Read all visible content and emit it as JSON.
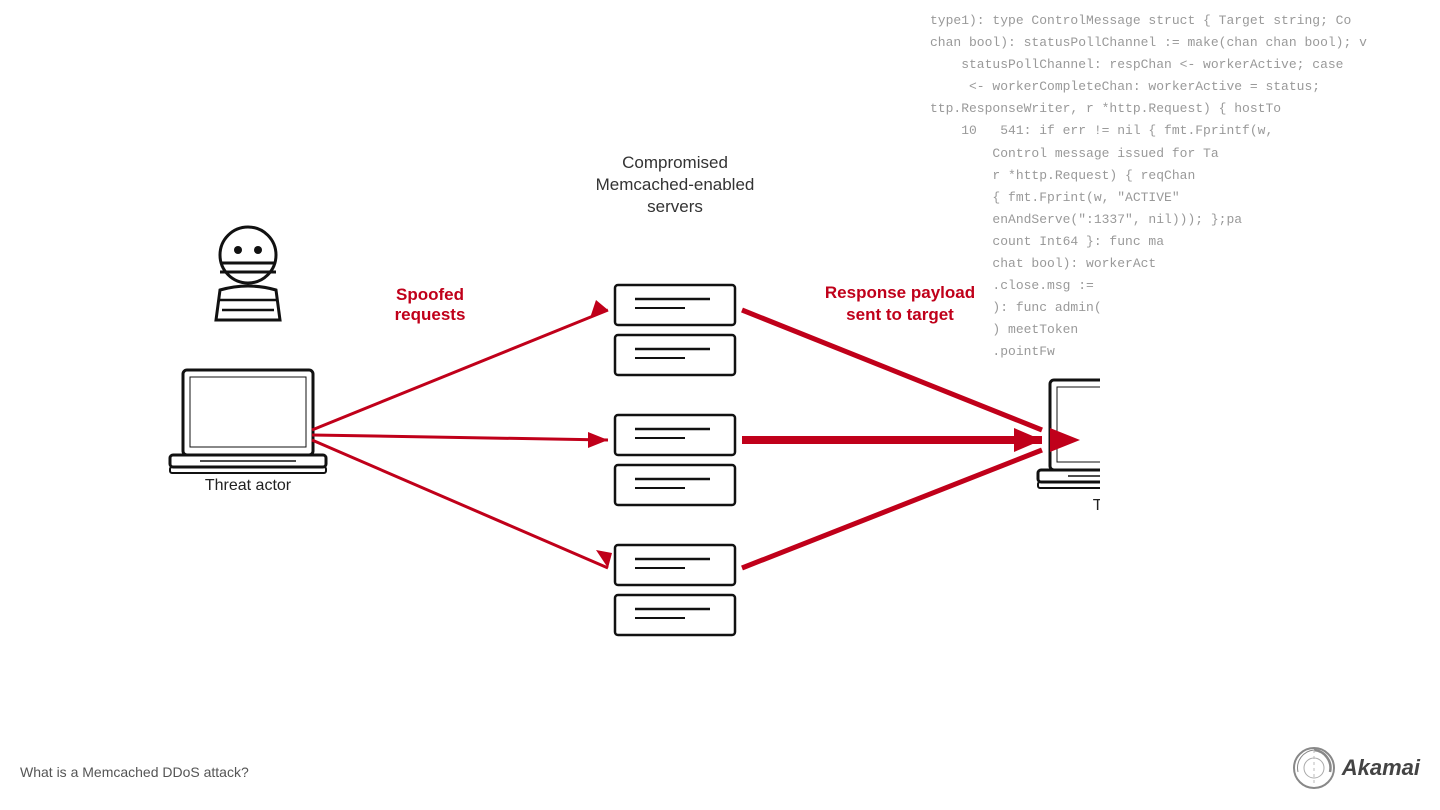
{
  "code_lines": [
    "type1): type ControlMessage struct { Target string; Co",
    "chan bool): statusPollChannel := make(chan chan bool); v",
    "statusPollChannel: respChan <- workerActive; case",
    "<- workerCompleteChan: workerActive = status;",
    "ttp.ResponseWriter, r *http.Request) { hostTo",
    "  10   541: if err != nil { fmt.Fprintf(w,",
    "  Control message issued for Ta",
    "  r *http.Request) { reqChan",
    "  { fmt.Fprint(w, \"ACTIVE\"",
    "  enAndServe(\":1337\", nil))); };pa",
    "  count Int64 }: func ma",
    "  chat bool): workerAct",
    "  .close.msg :=",
    "  ): func admin(",
    "  ) meetToken",
    "  .pointFw"
  ],
  "labels": {
    "compromised_servers": "Compromised\nMemcached-enabled\nservers",
    "compromised_line1": "Compromised",
    "compromised_line2": "Memcached-enabled",
    "compromised_line3": "servers",
    "spoofed_line1": "Spoofed",
    "spoofed_line2": "requests",
    "response_line1": "Response payload",
    "response_line2": "sent to target",
    "threat_actor": "Threat actor",
    "target": "Target",
    "bottom_caption": "What is a Memcached DDoS attack?",
    "akamai": "Akamai"
  },
  "colors": {
    "red": "#c0001a",
    "dark": "#111111",
    "gray": "#888888",
    "label": "#333333"
  }
}
